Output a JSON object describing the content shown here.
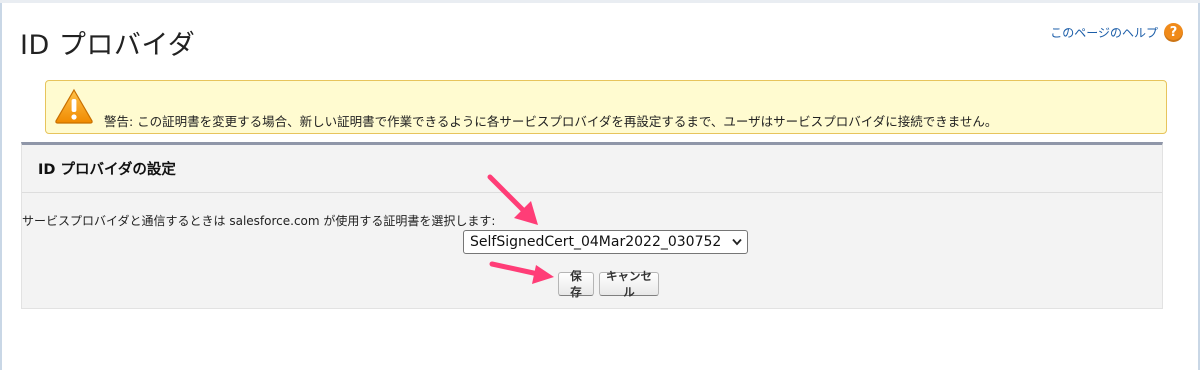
{
  "page": {
    "title": "ID プロバイダ",
    "help_link": "このページのヘルプ",
    "help_icon_glyph": "?"
  },
  "warning": {
    "icon": "warning-triangle-icon",
    "text": "警告: この証明書を変更する場合、新しい証明書で作業できるように各サービスプロバイダを再設定するまで、ユーザはサービスプロバイダに接続できません。"
  },
  "settings": {
    "title": "ID プロバイダの設定",
    "description": "サービスプロバイダと通信するときは salesforce.com が使用する証明書を選択します:",
    "certificate_select": {
      "selected": "SelfSignedCert_04Mar2022_030752"
    },
    "save_label": "保存",
    "cancel_label": "キャンセル"
  },
  "annotations": {
    "arrow_color": "#ff3d77"
  },
  "colors": {
    "link": "#1b5da8",
    "warning_bg": "#fffbd0",
    "warning_border": "#e7c45c",
    "section_bg": "#f3f3f3",
    "help_icon": "#f08a1a"
  }
}
